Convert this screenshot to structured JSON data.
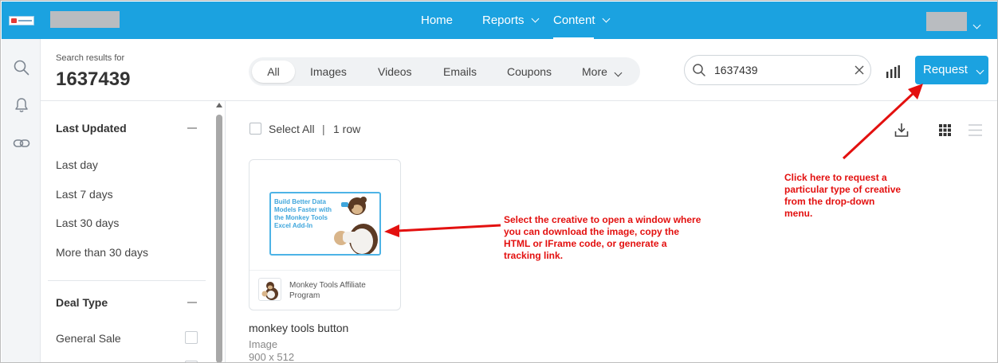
{
  "topnav": {
    "home": "Home",
    "reports": "Reports",
    "content": "Content"
  },
  "header": {
    "search_results_label": "Search results for",
    "search_term": "1637439"
  },
  "tabs": [
    "All",
    "Images",
    "Videos",
    "Emails",
    "Coupons",
    "More"
  ],
  "search": {
    "value": "1637439"
  },
  "request_button": "Request",
  "filters": {
    "last_updated": {
      "title": "Last Updated",
      "items": [
        "Last day",
        "Last 7 days",
        "Last 30 days",
        "More than 30 days"
      ]
    },
    "deal_type": {
      "title": "Deal Type",
      "items": [
        "General Sale"
      ]
    }
  },
  "results": {
    "select_all": "Select All",
    "separator": "|",
    "row_count": "1 row"
  },
  "card": {
    "creative_text": "Build Better Data Models Faster with the Monkey Tools Excel Add-In",
    "affiliate_name": "Monkey Tools Affiliate Program",
    "title": "monkey tools button",
    "type": "Image",
    "size": "900 x 512"
  },
  "annotations": {
    "creative_note": "Select the creative to open a window where you can download the image, copy the HTML or IFrame code, or generate a tracking link.",
    "request_note": "Click here to request a particular type of creative from the drop-down menu."
  },
  "colors": {
    "brand_blue": "#1ba2e0",
    "annotation_red": "#e3100f"
  }
}
